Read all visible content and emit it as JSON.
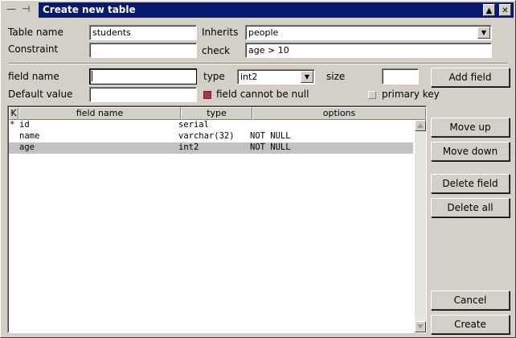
{
  "window": {
    "title": "Create new table",
    "minimize_glyph": "—",
    "pin_glyph": "⊣",
    "close_glyph": "✕",
    "maximize_glyph": "▲"
  },
  "form": {
    "table_name_label": "Table name",
    "table_name_value": "students",
    "inherits_label": "Inherits",
    "inherits_value": "people",
    "constraint_label": "Constraint",
    "constraint_value": "",
    "check_label": "check",
    "check_value": "age > 10",
    "field_name_label": "field name",
    "field_name_value": "",
    "type_label": "type",
    "type_value": "int2",
    "size_label": "size",
    "size_value": "",
    "default_value_label": "Default value",
    "default_value_value": "",
    "not_null_label": "field cannot be null",
    "not_null_checked": true,
    "primary_key_label": "primary key",
    "primary_key_checked": false,
    "add_field_label": "Add field"
  },
  "table": {
    "columns": [
      "K",
      "field name",
      "type",
      "options"
    ],
    "rows": [
      {
        "key": "*",
        "name": "id",
        "type": "serial",
        "options": ""
      },
      {
        "key": "",
        "name": "name",
        "type": "varchar(32)",
        "options": "NOT NULL"
      },
      {
        "key": "",
        "name": "age",
        "type": "int2",
        "options": "NOT NULL",
        "selected": true
      }
    ]
  },
  "actions": {
    "move_up": "Move up",
    "move_down": "Move down",
    "delete_field": "Delete field",
    "delete_all": "Delete all",
    "cancel": "Cancel",
    "create": "Create"
  },
  "colors": {
    "titlebar": "#0a1a6e",
    "checked": "#b03050",
    "selected_row": "#c2c2c2"
  }
}
